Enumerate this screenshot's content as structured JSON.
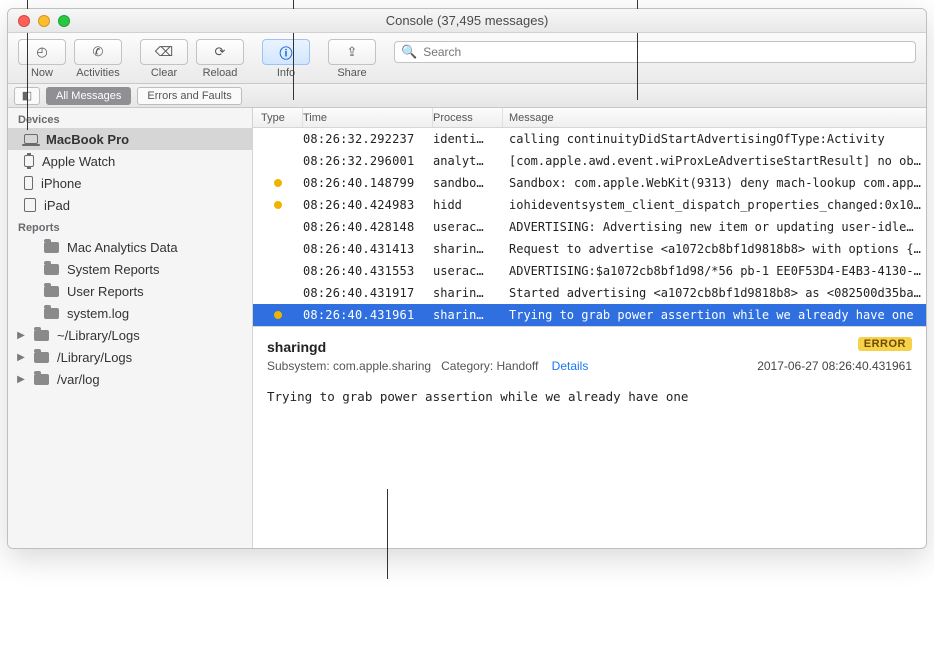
{
  "window": {
    "title": "Console (37,495 messages)"
  },
  "toolbar": {
    "now": "Now",
    "activities": "Activities",
    "clear": "Clear",
    "reload": "Reload",
    "info": "Info",
    "share": "Share",
    "search_placeholder": "Search"
  },
  "filter": {
    "all_messages": "All Messages",
    "errors_faults": "Errors and Faults"
  },
  "sidebar": {
    "devices_header": "Devices",
    "devices": [
      {
        "label": "MacBook Pro"
      },
      {
        "label": "Apple Watch"
      },
      {
        "label": "iPhone"
      },
      {
        "label": "iPad"
      }
    ],
    "reports_header": "Reports",
    "reports": [
      {
        "label": "Mac Analytics Data"
      },
      {
        "label": "System Reports"
      },
      {
        "label": "User Reports"
      },
      {
        "label": "system.log"
      },
      {
        "label": "~/Library/Logs"
      },
      {
        "label": "/Library/Logs"
      },
      {
        "label": "/var/log"
      }
    ]
  },
  "columns": {
    "type": "Type",
    "time": "Time",
    "process": "Process",
    "message": "Message"
  },
  "rows": [
    {
      "dot": false,
      "time": "08:26:32.292237",
      "proc": "identi…",
      "msg": "calling continuityDidStartAdvertisingOfType:Activity"
    },
    {
      "dot": false,
      "time": "08:26:32.296001",
      "proc": "analyt…",
      "msg": "[com.apple.awd.event.wiProxLeAdvertiseStartResult] no ob…"
    },
    {
      "dot": true,
      "time": "08:26:40.148799",
      "proc": "sandbo…",
      "msg": "Sandbox: com.apple.WebKit(9313) deny mach-lookup com.app…"
    },
    {
      "dot": true,
      "time": "08:26:40.424983",
      "proc": "hidd",
      "msg": "iohideventsystem_client_dispatch_properties_changed:0x10…"
    },
    {
      "dot": false,
      "time": "08:26:40.428148",
      "proc": "userac…",
      "msg": "ADVERTISING: Advertising new item or updating user-idle…"
    },
    {
      "dot": false,
      "time": "08:26:40.431413",
      "proc": "sharin…",
      "msg": "Request to advertise <a1072cb8bf1d9818b8> with options {…"
    },
    {
      "dot": false,
      "time": "08:26:40.431553",
      "proc": "userac…",
      "msg": "ADVERTISING:$a1072cb8bf1d98/*56 pb-1 EE0F53D4-E4B3-4130-…"
    },
    {
      "dot": false,
      "time": "08:26:40.431917",
      "proc": "sharin…",
      "msg": "Started advertising <a1072cb8bf1d9818b8> as <082500d35ba…"
    },
    {
      "dot": true,
      "time": "08:26:40.431961",
      "proc": "sharin…",
      "msg": "Trying to grab power assertion while we already have one"
    }
  ],
  "detail": {
    "process": "sharingd",
    "subsystem_label": "Subsystem:",
    "subsystem": "com.apple.sharing",
    "category_label": "Category:",
    "category": "Handoff",
    "details_link": "Details",
    "error_badge": "ERROR",
    "timestamp": "2017-06-27 08:26:40.431961",
    "body": "Trying to grab power assertion while we already have one"
  }
}
